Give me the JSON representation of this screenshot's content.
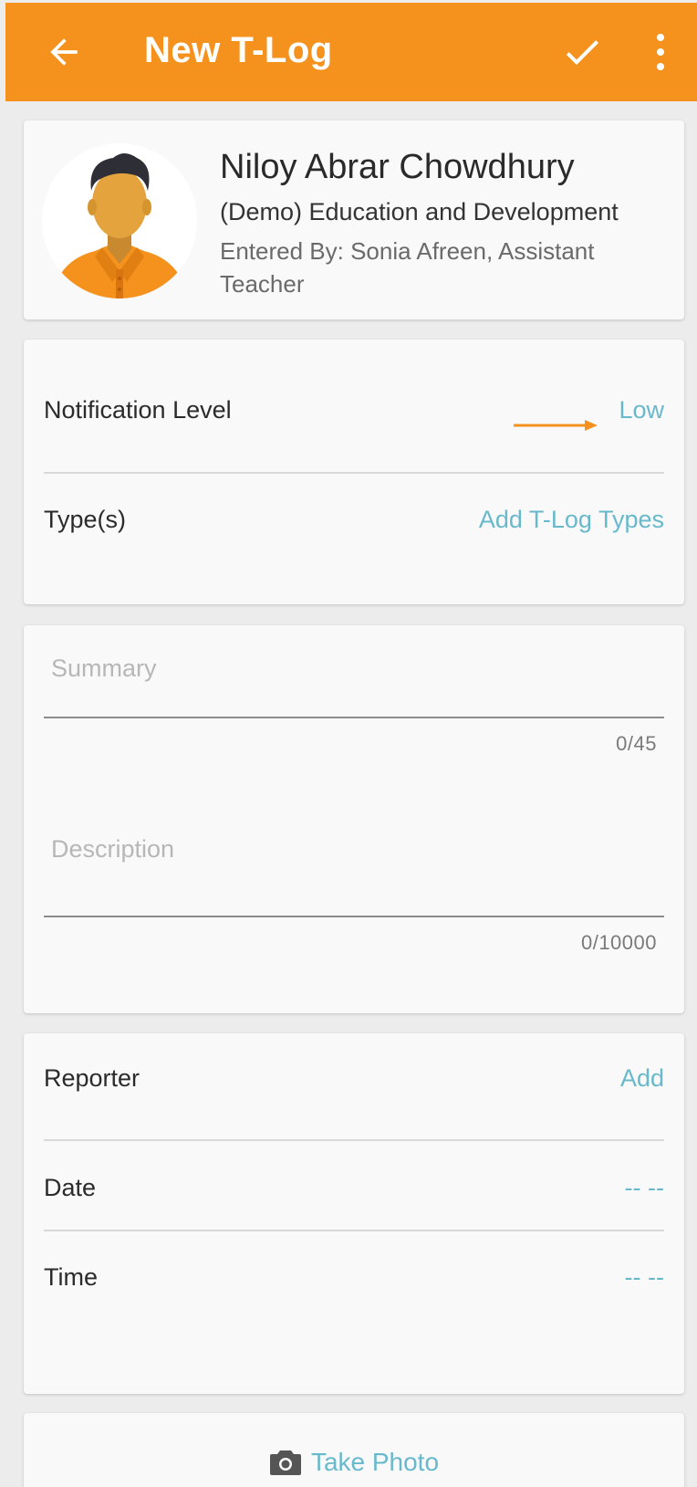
{
  "app_bar": {
    "title": "New T-Log",
    "background": "#f5921e",
    "icons": [
      "back-arrow-icon",
      "check-icon",
      "more-vert-icon"
    ]
  },
  "profile": {
    "name": "Niloy Abrar Chowdhury",
    "organization": "(Demo) Education and Development",
    "entered_by": "Entered By: Sonia Afreen, Assistant Teacher",
    "avatar_icon": "person-avatar-icon"
  },
  "classification": {
    "notification_level_label": "Notification Level",
    "notification_level_value": "Low",
    "types_label": "Type(s)",
    "types_action": "Add T-Log Types"
  },
  "entry": {
    "summary_placeholder": "Summary",
    "summary_counter": "0/45",
    "description_placeholder": "Description",
    "description_counter": "0/10000"
  },
  "details": {
    "reporter_label": "Reporter",
    "reporter_action": "Add",
    "date_label": "Date",
    "date_value": "-- --",
    "time_label": "Time",
    "time_value": "-- --"
  },
  "photo": {
    "label": "Take Photo",
    "icon": "camera-icon"
  },
  "colors": {
    "accent": "#f5921e",
    "link": "#68b9cc"
  }
}
